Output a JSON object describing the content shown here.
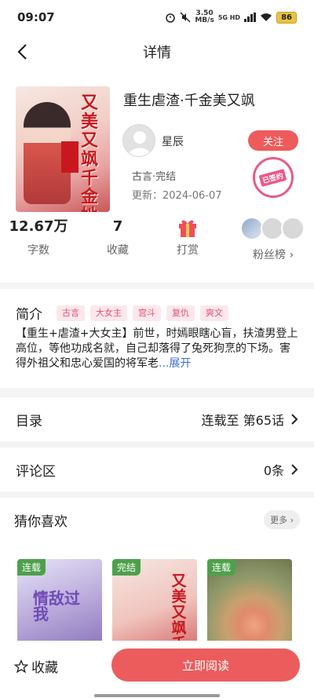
{
  "status": {
    "time": "09:07",
    "speed": "3.50",
    "speed_unit": "MB/s",
    "network": "5G HD",
    "battery": "86"
  },
  "header": {
    "title": "详情"
  },
  "book": {
    "title": "重生虐渣·千金美又飒",
    "author": "星辰",
    "follow_label": "关注",
    "genre": "古言·完结",
    "updated": "更新：2024-06-07",
    "signed_label": "已签约",
    "cover_title": "又美又飒千金她"
  },
  "stats": {
    "words_value": "12.67万",
    "words_label": "字数",
    "favs_value": "7",
    "favs_label": "收藏",
    "reward_label": "打赏",
    "fans_label": "粉丝榜"
  },
  "intro": {
    "title": "简介",
    "tags": [
      "古言",
      "大女主",
      "宫斗",
      "复仇",
      "爽文"
    ],
    "text": "【重生+虐渣+大女主】前世，时嫣眼瞎心盲，扶渣男登上高位，等他功成名就，自己却落得了兔死狗烹的下场。害得外祖父和忠心爱国的将军老",
    "more": "...展开"
  },
  "catalog": {
    "label": "目录",
    "value": "连载至 第65话"
  },
  "comments": {
    "label": "评论区",
    "value": "0条"
  },
  "recommend": {
    "title": "猜你喜欢",
    "more": "更多",
    "items": [
      {
        "badge": "连载",
        "cover_text": "情敌过我"
      },
      {
        "badge": "完结",
        "cover_text": "又美又飒千金她"
      },
      {
        "badge": "连载",
        "cover_text": ""
      }
    ]
  },
  "bottom": {
    "fav_label": "收藏",
    "read_label": "立即阅读"
  }
}
